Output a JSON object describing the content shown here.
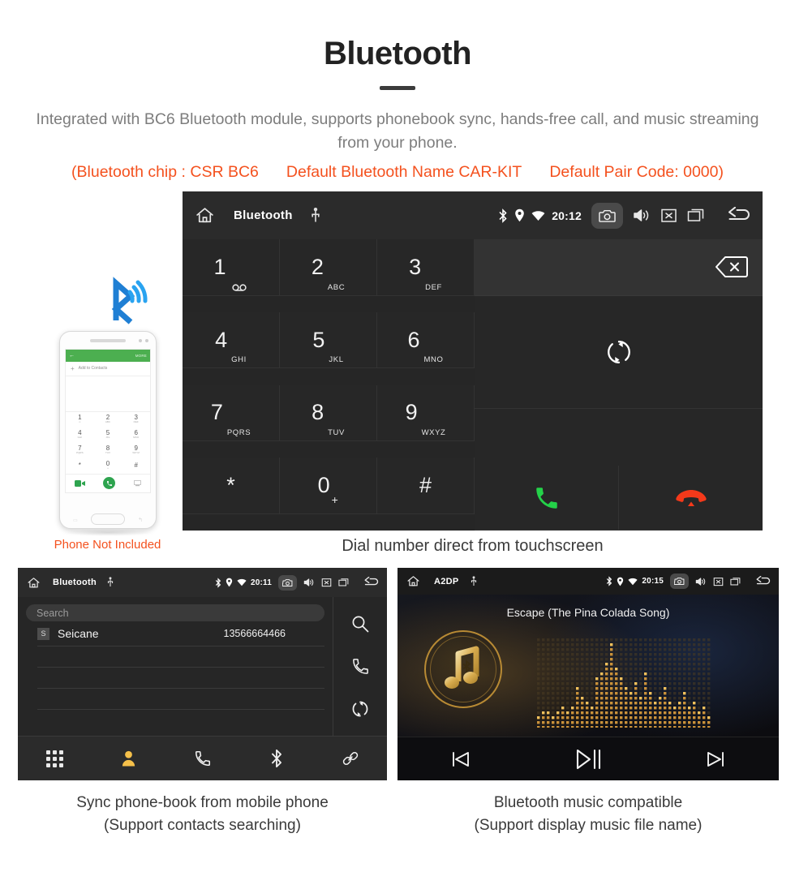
{
  "hero": {
    "title": "Bluetooth",
    "description": "Integrated with BC6 Bluetooth module, supports phonebook sync, hands-free call, and music streaming from your phone.",
    "spec_chip": "(Bluetooth chip : CSR BC6",
    "spec_name": "Default Bluetooth Name CAR-KIT",
    "spec_pair": "Default Pair Code: 0000)",
    "accent_color": "#f4511e",
    "text_color": "#7d7d7d"
  },
  "phone_mock": {
    "note": "Phone Not Included",
    "app_more": "MORE",
    "add_contacts": "Add to Contacts",
    "back_glyph": "←",
    "plus_glyph": "+",
    "keys": [
      {
        "digit": "1",
        "sub": "∞"
      },
      {
        "digit": "2",
        "sub": "ABC"
      },
      {
        "digit": "3",
        "sub": "DEF"
      },
      {
        "digit": "4",
        "sub": "GHI"
      },
      {
        "digit": "5",
        "sub": "JKL"
      },
      {
        "digit": "6",
        "sub": "MNO"
      },
      {
        "digit": "7",
        "sub": "PQRS"
      },
      {
        "digit": "8",
        "sub": "TUV"
      },
      {
        "digit": "9",
        "sub": "WXYZ"
      },
      {
        "digit": "*",
        "sub": ""
      },
      {
        "digit": "0",
        "sub": "+"
      },
      {
        "digit": "#",
        "sub": ""
      }
    ]
  },
  "dialer": {
    "statusbar": {
      "title": "Bluetooth",
      "time": "20:12",
      "icons": [
        "home-icon",
        "usb-icon",
        "bluetooth-icon",
        "location-icon",
        "wifi-icon",
        "camera-icon",
        "volume-icon",
        "close-icon",
        "recent-apps-icon",
        "back-icon"
      ]
    },
    "keys": [
      {
        "digit": "1",
        "sub": "",
        "voicemail": true
      },
      {
        "digit": "2",
        "sub": "ABC"
      },
      {
        "digit": "3",
        "sub": "DEF"
      },
      {
        "digit": "4",
        "sub": "GHI"
      },
      {
        "digit": "5",
        "sub": "JKL"
      },
      {
        "digit": "6",
        "sub": "MNO"
      },
      {
        "digit": "7",
        "sub": "PQRS"
      },
      {
        "digit": "8",
        "sub": "TUV"
      },
      {
        "digit": "9",
        "sub": "WXYZ"
      },
      {
        "digit": "*",
        "sub": ""
      },
      {
        "digit": "0",
        "sub": "+"
      },
      {
        "digit": "#",
        "sub": ""
      }
    ],
    "number_input_value": "",
    "tabs": [
      {
        "name": "keypad",
        "active": true
      },
      {
        "name": "contacts",
        "active": false
      },
      {
        "name": "call-log",
        "active": false
      },
      {
        "name": "bluetooth",
        "active": false
      },
      {
        "name": "link",
        "active": false
      }
    ],
    "active_tab_color": "#f5c04a",
    "call_button_color": "#24d149",
    "hangup_button_color": "#f4391a",
    "caption": "Dial number direct from touchscreen"
  },
  "phonebook": {
    "statusbar": {
      "title": "Bluetooth",
      "time": "20:11"
    },
    "search_placeholder": "Search",
    "search_value": "",
    "contacts": [
      {
        "initial": "S",
        "name": "Seicane",
        "number": "13566664466"
      }
    ],
    "side_actions": [
      "search-icon",
      "call-icon",
      "sync-icon"
    ],
    "tabs": [
      {
        "name": "keypad",
        "active": false
      },
      {
        "name": "contacts",
        "active": true
      },
      {
        "name": "call-log",
        "active": false
      },
      {
        "name": "bluetooth",
        "active": false
      },
      {
        "name": "link",
        "active": false
      }
    ],
    "caption_line1": "Sync phone-book from mobile phone",
    "caption_line2": "(Support contacts searching)"
  },
  "music": {
    "statusbar": {
      "title": "A2DP",
      "time": "20:15"
    },
    "song_title": "Escape (The Pina Colada Song)",
    "controls": [
      "previous-icon",
      "play-pause-icon",
      "next-icon"
    ],
    "accent_color": "#d9a441",
    "caption_line1": "Bluetooth music compatible",
    "caption_line2": "(Support display music file name)"
  }
}
